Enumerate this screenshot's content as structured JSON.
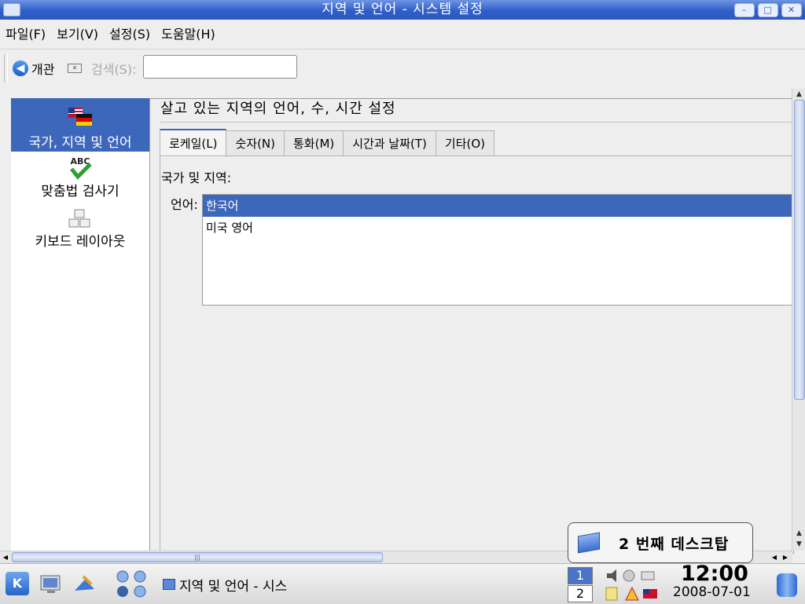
{
  "window": {
    "title": "지역 및 언어 - 시스템 설정"
  },
  "menu": {
    "items": [
      "파일(F)",
      "보기(V)",
      "설정(S)",
      "도움말(H)"
    ]
  },
  "toolbar": {
    "overview": "개관",
    "search_label": "검색(S):",
    "search_value": ""
  },
  "sidebar": {
    "items": [
      {
        "label": "국가, 지역 및 언어",
        "icon": "flags-icon",
        "selected": true
      },
      {
        "label": "맞춤법 검사기",
        "icon": "spellcheck-icon",
        "selected": false
      },
      {
        "label": "키보드 레이아웃",
        "icon": "keyboard-icon",
        "selected": false
      }
    ]
  },
  "content": {
    "title": "살고 있는 지역의 언어, 수, 시간 설정",
    "tabs": [
      "로케일(L)",
      "숫자(N)",
      "통화(M)",
      "시간과 날짜(T)",
      "기타(O)"
    ],
    "active_tab": 0,
    "country_label": "국가 및 지역:",
    "language_label": "언어:",
    "languages": [
      "한국어",
      "미국 영어"
    ],
    "selected_language": 0
  },
  "popup": {
    "text": "2 번째 데스크탑"
  },
  "taskbar": {
    "task_title": "지역 및 언어 - 시스",
    "pager_desktops": [
      "1",
      "2"
    ],
    "clock_time": "12:00",
    "clock_date": "2008-07-01"
  },
  "colors": {
    "selection": "#3d67bb",
    "titlebar": "#2e5ec8"
  }
}
